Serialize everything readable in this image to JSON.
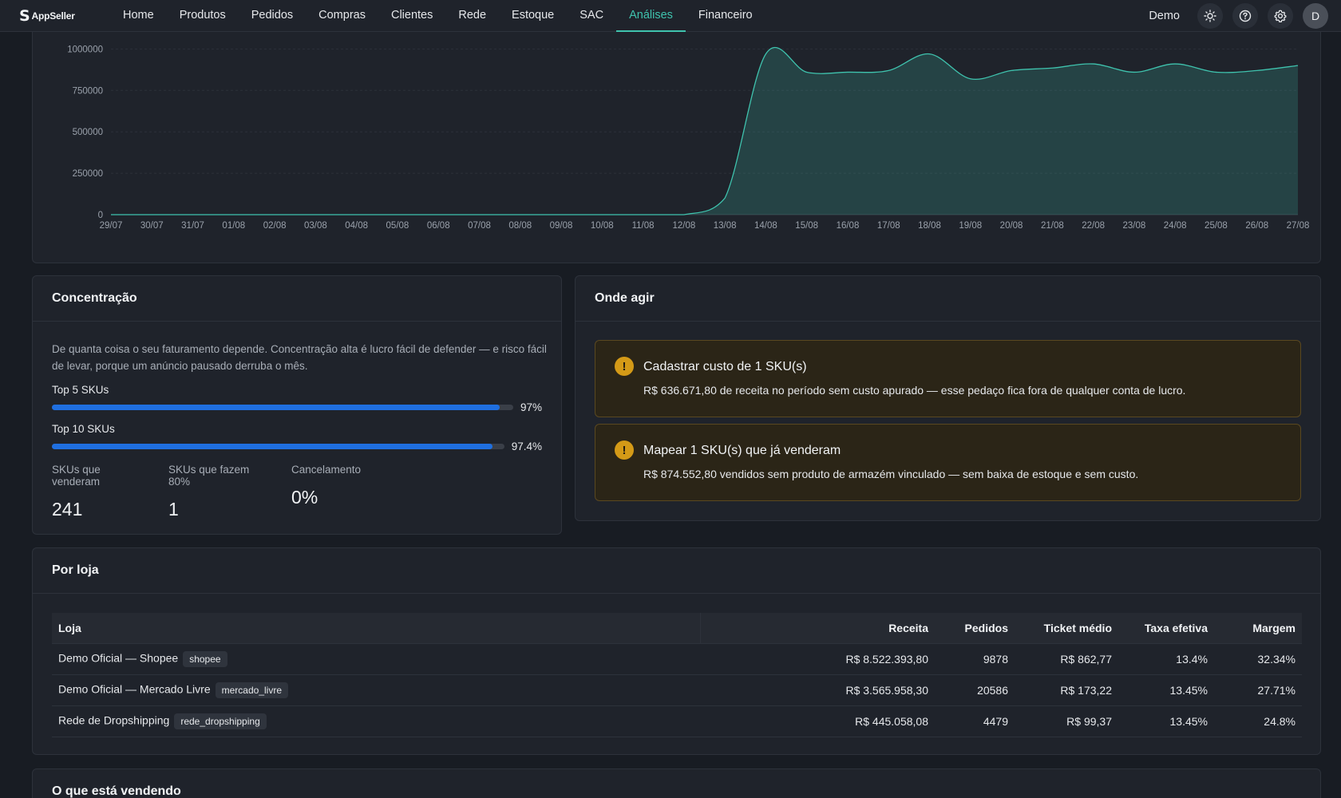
{
  "app": {
    "brand": "AppSeller",
    "brand_mark": "S"
  },
  "nav": {
    "items": [
      "Home",
      "Produtos",
      "Pedidos",
      "Compras",
      "Clientes",
      "Rede",
      "Estoque",
      "SAC",
      "Análises",
      "Financeiro"
    ],
    "active": "Análises"
  },
  "user": {
    "name": "Demo",
    "initial": "D"
  },
  "colors": {
    "accent": "#3fc3ae",
    "bar": "#1f6fe0",
    "warning": "#d49a17",
    "background": "#181c23",
    "card": "#1f232b"
  },
  "chart_data": {
    "type": "area",
    "x": [
      "29/07",
      "30/07",
      "31/07",
      "01/08",
      "02/08",
      "03/08",
      "04/08",
      "05/08",
      "06/08",
      "07/08",
      "08/08",
      "09/08",
      "10/08",
      "11/08",
      "12/08",
      "13/08",
      "14/08",
      "15/08",
      "16/08",
      "17/08",
      "18/08",
      "19/08",
      "20/08",
      "21/08",
      "22/08",
      "23/08",
      "24/08",
      "25/08",
      "26/08",
      "27/08"
    ],
    "values": [
      0,
      0,
      0,
      0,
      0,
      0,
      0,
      0,
      0,
      0,
      0,
      0,
      0,
      0,
      0,
      100000,
      970000,
      860000,
      860000,
      870000,
      970000,
      820000,
      870000,
      885000,
      910000,
      860000,
      910000,
      860000,
      870000,
      900000
    ],
    "y_ticks": [
      0,
      250000,
      500000,
      750000,
      1000000
    ],
    "ylim": [
      0,
      1050000
    ],
    "grid": true,
    "series_color": "#3fc3ae"
  },
  "concentracao": {
    "title": "Concentração",
    "description": "De quanta coisa o seu faturamento depende. Concentração alta é lucro fácil de defender — e risco fácil de levar, porque um anúncio pausado derruba o mês.",
    "bars": [
      {
        "label": "Top 5 SKUs",
        "pct_label": "97%",
        "value": 97
      },
      {
        "label": "Top 10 SKUs",
        "pct_label": "97.4%",
        "value": 97.4
      }
    ],
    "stats": [
      {
        "label": "SKUs que venderam",
        "value": "241"
      },
      {
        "label": "SKUs que fazem 80%",
        "value": "1"
      },
      {
        "label": "Cancelamento",
        "value": "0%"
      }
    ]
  },
  "onde_agir": {
    "title": "Onde agir",
    "alerts": [
      {
        "icon": "!",
        "title": "Cadastrar custo de 1 SKU(s)",
        "text": "R$ 636.671,80 de receita no período sem custo apurado — esse pedaço fica fora de qualquer conta de lucro."
      },
      {
        "icon": "!",
        "title": "Mapear 1 SKU(s) que já venderam",
        "text": "R$ 874.552,80 vendidos sem produto de armazém vinculado — sem baixa de estoque e sem custo."
      }
    ]
  },
  "por_loja": {
    "title": "Por loja",
    "columns": [
      "Loja",
      "Receita",
      "Pedidos",
      "Ticket médio",
      "Taxa efetiva",
      "Margem"
    ],
    "rows": [
      {
        "loja": "Demo Oficial — Shopee",
        "tag": "shopee",
        "receita": "R$ 8.522.393,80",
        "pedidos": "9878",
        "ticket": "R$ 862,77",
        "taxa": "13.4%",
        "margem": "32.34%"
      },
      {
        "loja": "Demo Oficial — Mercado Livre",
        "tag": "mercado_livre",
        "receita": "R$ 3.565.958,30",
        "pedidos": "20586",
        "ticket": "R$ 173,22",
        "taxa": "13.45%",
        "margem": "27.71%"
      },
      {
        "loja": "Rede de Dropshipping",
        "tag": "rede_dropshipping",
        "receita": "R$ 445.058,08",
        "pedidos": "4479",
        "ticket": "R$ 99,37",
        "taxa": "13.45%",
        "margem": "24.8%"
      }
    ]
  },
  "selling": {
    "title": "O que está vendendo"
  }
}
